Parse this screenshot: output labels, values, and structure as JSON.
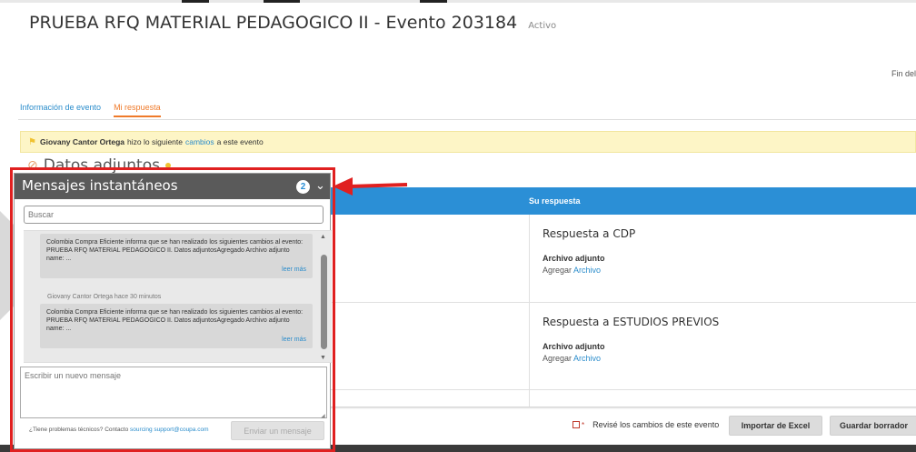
{
  "header": {
    "title": "PRUEBA RFQ MATERIAL PEDAGOGICO II - Evento 203184",
    "status": "Activo",
    "end_label": "Fin del"
  },
  "tabs": [
    {
      "label": "Información de evento",
      "active": false
    },
    {
      "label": "Mi respuesta",
      "active": true
    }
  ],
  "notice": {
    "user": "Giovany Cantor Ortega",
    "text_before": "hizo lo siguiente",
    "link": "cambios",
    "text_after": "a este evento"
  },
  "attachments": {
    "heading": "Datos adjuntos"
  },
  "table": {
    "response_header": "Su respuesta",
    "rows": [
      {
        "title": "Respuesta a CDP",
        "attachment_label": "Archivo adjunto",
        "add_prefix": "Agregar",
        "add_link": "Archivo"
      },
      {
        "title": "Respuesta a ESTUDIOS PREVIOS",
        "attachment_label": "Archivo adjunto",
        "add_prefix": "Agregar",
        "add_link": "Archivo"
      }
    ]
  },
  "footer_actions": {
    "confirm_label": "Revisé los cambios de este evento",
    "import_button": "Importar de Excel",
    "save_button": "Guardar borrador"
  },
  "instant_messages": {
    "title": "Mensajes instantáneos",
    "badge_count": "2",
    "search_placeholder": "Buscar",
    "messages": [
      {
        "body": "Colombia Compra Eficiente informa que se han realizado los siguientes cambios al evento: PRUEBA RFQ MATERIAL PEDAGOGICO II. Datos adjuntosAgregado Archivo adjunto name: ...",
        "more": "leer más"
      },
      {
        "meta": "Giovany Cantor Ortega hace 30 minutos",
        "body": "Colombia Compra Eficiente informa que se han realizado los siguientes cambios al evento: PRUEBA RFQ MATERIAL PEDAGOGICO II. Datos adjuntosAgregado Archivo adjunto name: ...",
        "more": "leer más"
      }
    ],
    "new_message_placeholder": "Escribir un nuevo mensaje",
    "help_text": "¿Tiene problemas técnicos? Contacto",
    "help_link": "sourcing support@coupa.com",
    "send_button": "Enviar un mensaje"
  },
  "colors": {
    "accent_blue": "#2b8fd6",
    "active_tab": "#ef7a2a",
    "notice_bg": "#fdf5c6",
    "highlight": "#e02020",
    "panel_header": "#5a5a5a"
  }
}
